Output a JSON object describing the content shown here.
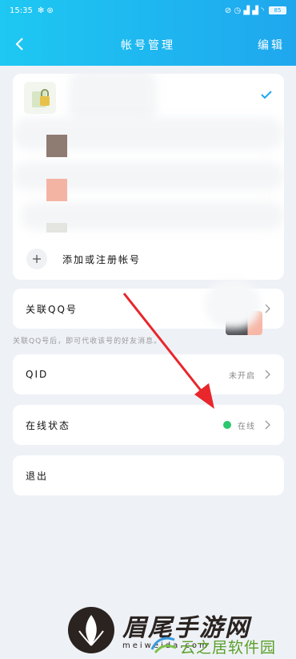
{
  "status_bar": {
    "time": "15:35",
    "battery": "85"
  },
  "header": {
    "title": "帐号管理",
    "edit_label": "编辑"
  },
  "account_card": {
    "add_label": "添加或注册帐号"
  },
  "link_qq": {
    "label": "关联QQ号",
    "hint": "关联QQ号后，即可代收该号的好友消息。"
  },
  "qid": {
    "label": "QID",
    "value": "未开启"
  },
  "online_status": {
    "label": "在线状态",
    "value": "在线",
    "dot_color": "#2ac86f"
  },
  "logout": {
    "label": "退出"
  },
  "watermark": {
    "brand": "眉尾手游网",
    "url": "meiweida.com",
    "site": "云之居软件园"
  },
  "colors": {
    "header_start": "#1ec8f2",
    "header_end": "#1fa7ee",
    "accent": "#1fa7ee",
    "arrow": "#e8262c"
  }
}
